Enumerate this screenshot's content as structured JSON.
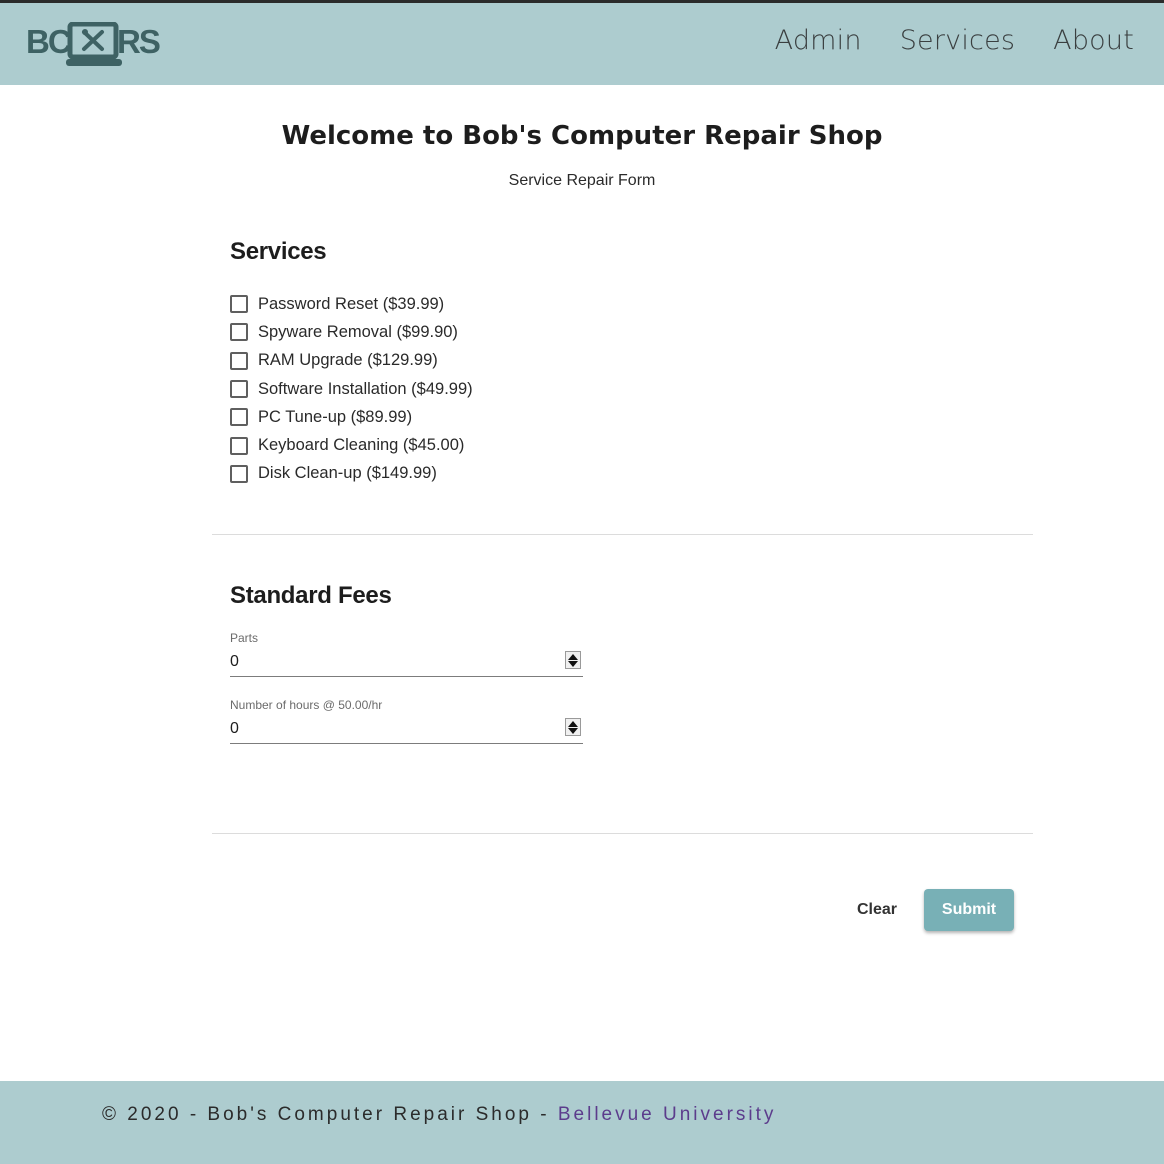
{
  "brand": {
    "logo_text_left": "BC",
    "logo_text_right": "RS",
    "logo_icon": "laptop-tools-icon"
  },
  "nav": {
    "items": [
      "Admin",
      "Services",
      "About"
    ]
  },
  "page": {
    "title": "Welcome to Bob's Computer Repair Shop",
    "subtitle": "Service Repair Form"
  },
  "services": {
    "heading": "Services",
    "items": [
      {
        "label": "Password Reset ($39.99)",
        "checked": false
      },
      {
        "label": "Spyware Removal ($99.90)",
        "checked": false
      },
      {
        "label": "RAM Upgrade ($129.99)",
        "checked": false
      },
      {
        "label": "Software Installation ($49.99)",
        "checked": false
      },
      {
        "label": "PC Tune-up ($89.99)",
        "checked": false
      },
      {
        "label": "Keyboard Cleaning ($45.00)",
        "checked": false
      },
      {
        "label": "Disk Clean-up ($149.99)",
        "checked": false
      }
    ]
  },
  "fees": {
    "heading": "Standard Fees",
    "parts": {
      "label": "Parts",
      "value": "0"
    },
    "hours": {
      "label": "Number of hours @ 50.00/hr",
      "value": "0"
    }
  },
  "actions": {
    "clear_label": "Clear",
    "submit_label": "Submit"
  },
  "footer": {
    "text": "© 2020 - Bob's Computer Repair Shop - ",
    "link": "Bellevue University"
  },
  "colors": {
    "header_bg": "#adcccf",
    "logo": "#3e6264",
    "submit_bg": "#78b0b6",
    "footer_link": "#5c3c8c"
  }
}
